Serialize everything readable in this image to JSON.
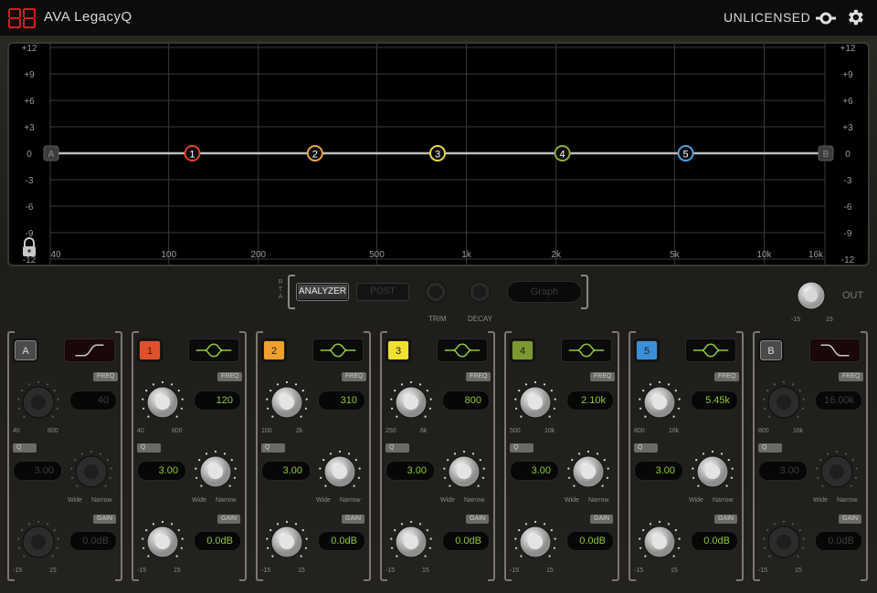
{
  "header": {
    "title": "AVA LegacyQ",
    "license": "UNLICENSED"
  },
  "graph": {
    "db_labels": [
      "+12",
      "+9",
      "+6",
      "+3",
      "0",
      "-3",
      "-6",
      "-9",
      "-12"
    ],
    "freq_labels": [
      "40",
      "100",
      "200",
      "500",
      "1k",
      "2k",
      "5k",
      "10k",
      "16k"
    ],
    "nodes": [
      {
        "label": "A",
        "freq": 40,
        "color": "#555555"
      },
      {
        "label": "1",
        "freq": 120,
        "color": "#e0432a"
      },
      {
        "label": "2",
        "freq": 310,
        "color": "#e8a54a"
      },
      {
        "label": "3",
        "freq": 800,
        "color": "#e8d83a"
      },
      {
        "label": "4",
        "freq": 2100,
        "color": "#8aac3a"
      },
      {
        "label": "5",
        "freq": 5450,
        "color": "#4aa0e0"
      },
      {
        "label": "B",
        "freq": 16000,
        "color": "#555555"
      }
    ]
  },
  "rta": {
    "label": "RTA",
    "analyzer": "ANALYZER",
    "post": "POST",
    "trim": "TRIM",
    "decay": "DECAY",
    "graph": "Graph"
  },
  "output": {
    "label": "OUT",
    "min": "-15",
    "max": "15"
  },
  "labels": {
    "freq": "FREQ",
    "q": "Q",
    "gain": "GAIN",
    "wide": "Wide",
    "narrow": "Narrow",
    "gain_min": "-15",
    "gain_max": "15"
  },
  "bands": [
    {
      "id": "A",
      "color": "#6a6a6a",
      "active": false,
      "shape": "low-shelf",
      "freq": "40",
      "fmin": "40",
      "fmax": "800",
      "q": "3.00",
      "gain": "0.0dB"
    },
    {
      "id": "1",
      "color": "#e0502a",
      "active": true,
      "shape": "bell",
      "freq": "120",
      "fmin": "40",
      "fmax": "800",
      "q": "3.00",
      "gain": "0.0dB"
    },
    {
      "id": "2",
      "color": "#f0a030",
      "active": true,
      "shape": "bell",
      "freq": "310",
      "fmin": "100",
      "fmax": "2k",
      "q": "3.00",
      "gain": "0.0dB"
    },
    {
      "id": "3",
      "color": "#f0e030",
      "active": true,
      "shape": "bell",
      "freq": "800",
      "fmin": "250",
      "fmax": "6k",
      "q": "3.00",
      "gain": "0.0dB"
    },
    {
      "id": "4",
      "color": "#7a9a30",
      "active": true,
      "shape": "bell",
      "freq": "2.10k",
      "fmin": "500",
      "fmax": "10k",
      "q": "3.00",
      "gain": "0.0dB"
    },
    {
      "id": "5",
      "color": "#3a90d8",
      "active": true,
      "shape": "bell",
      "freq": "5.45k",
      "fmin": "800",
      "fmax": "16k",
      "q": "3.00",
      "gain": "0.0dB"
    },
    {
      "id": "B",
      "color": "#6a6a6a",
      "active": false,
      "shape": "high-shelf",
      "freq": "16.00k",
      "fmin": "800",
      "fmax": "16k",
      "q": "3.00",
      "gain": "0.0dB"
    }
  ]
}
